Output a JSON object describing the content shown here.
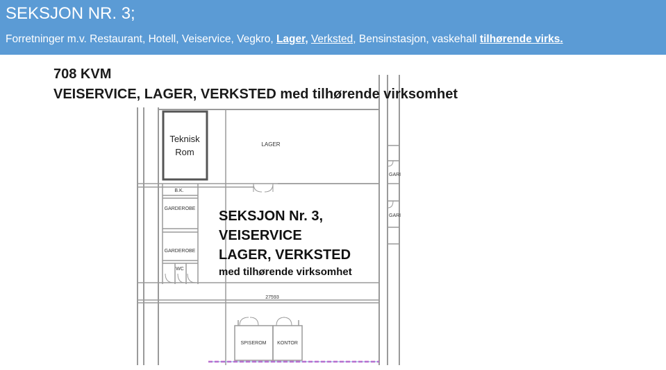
{
  "header": {
    "title": "SEKSJON NR. 3;",
    "subtitle_plain_1": "Forretninger m.v.  Restaurant, Hotell, Veiservice, Vegkro, ",
    "subtitle_lager": "Lager,",
    "subtitle_space": " ",
    "subtitle_verksted": "Verksted",
    "subtitle_plain_2": ", Bensinstasjon, vaskehall ",
    "subtitle_tilh": "tilhørende virks.",
    "background_color": "#5b9bd5",
    "text_color": "#ffffff"
  },
  "area": "708 KVM",
  "heading": "VEISERVICE, LAGER, VERKSTED med tilhørende virksomhet",
  "plan": {
    "room_teknisk_1": "Teknisk",
    "room_teknisk_2": "Rom",
    "room_lager": "LAGER",
    "room_bk": "B.K.",
    "room_garderobe_1": "GARDEROBE",
    "room_garderobe_2": "GARDEROBE",
    "room_wc": "WC",
    "room_spiserom": "SPISEROM",
    "room_kontor": "KONTOR",
    "room_gar_1": "GARI",
    "room_gar_2": "GARI",
    "dimension": "27593",
    "highlight_color": "#e040c0"
  },
  "overlay": {
    "line1": "SEKSJON Nr. 3,",
    "line2": "VEISERVICE",
    "line3": "LAGER, VERKSTED",
    "line4": "med tilhørende virksomhet"
  }
}
